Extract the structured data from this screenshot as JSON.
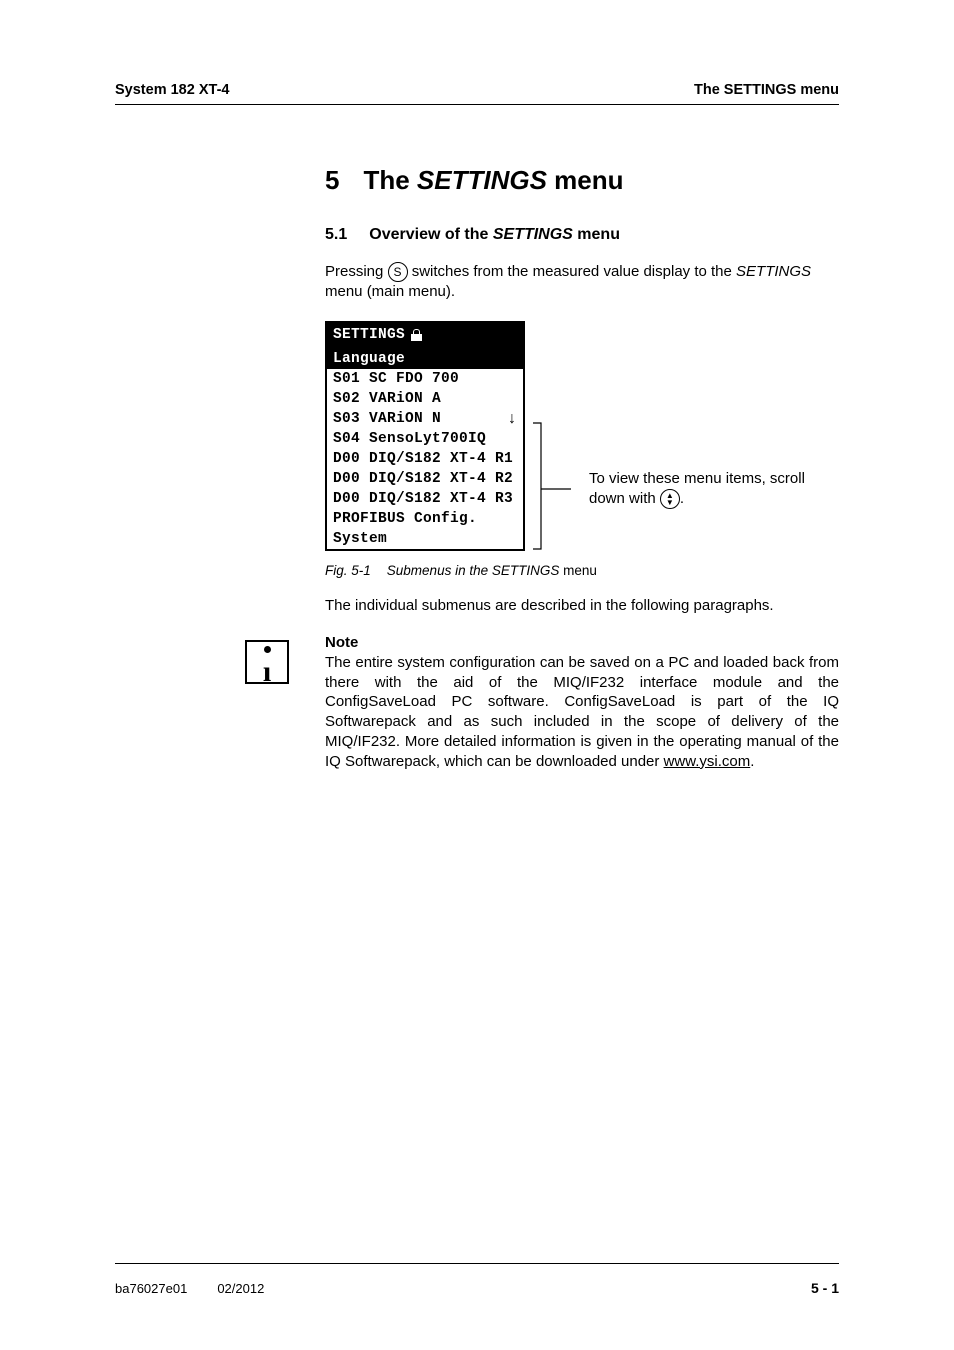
{
  "header": {
    "left": "System 182 XT-4",
    "right": "The SETTINGS menu"
  },
  "chapter": {
    "number": "5",
    "title_prefix": "The ",
    "title_italic": "SETTINGS",
    "title_suffix": " menu"
  },
  "section": {
    "number": "5.1",
    "title_prefix": "Overview of the ",
    "title_italic": "SETTINGS",
    "title_suffix": " menu"
  },
  "intro": {
    "part1": "Pressing ",
    "key_label": "S",
    "part2": " switches from the measured value display to the ",
    "italic": "SETTINGS",
    "part3": " menu (main menu)."
  },
  "lcd": {
    "header": "SETTINGS",
    "selected": "Language",
    "rows": [
      "S01 SC FDO 700",
      "S02 VARiON A",
      "S03 VARiON N",
      "S04 SensoLyt700IQ",
      "D00 DIQ/S182 XT-4 R1",
      "D00 DIQ/S182 XT-4 R2",
      "D00 DIQ/S182 XT-4 R3",
      "PROFIBUS Config.",
      "System"
    ],
    "arrow_row_index": 2
  },
  "callout": {
    "part1": "To view these menu items, scroll down with ",
    "part2": "."
  },
  "figcaption": {
    "num": "Fig. 5-1",
    "text_italic": "Submenus in the SETTINGS ",
    "text_upright": "menu"
  },
  "after_fig": "The individual submenus are described in the following paragraphs.",
  "note": {
    "title": "Note",
    "body_pre": "The entire system configuration can be saved on a PC and loaded back from there with the aid of the MIQ/IF232 interface module and the ConfigSaveLoad PC software. ConfigSaveLoad is part of the IQ Softwarepack and as such included in the scope of delivery of the MIQ/IF232. More detailed information is given in the operating manual of the IQ Softwarepack, which can be downloaded under ",
    "link": "www.ysi.com",
    "body_post": "."
  },
  "footer": {
    "doc": "ba76027e01",
    "date": "02/2012",
    "page": "5 - 1"
  }
}
